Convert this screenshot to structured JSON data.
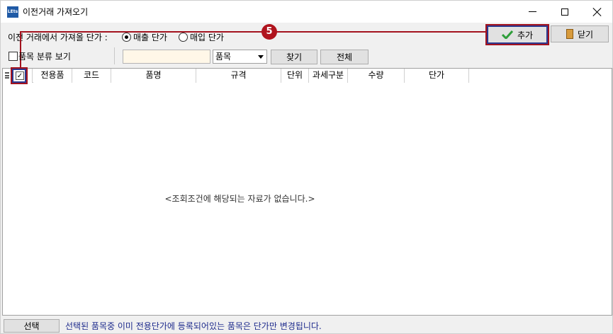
{
  "window": {
    "title": "이전거래 가져오기",
    "icon_label": "LEts"
  },
  "row1": {
    "source_label": "이전 거래에서 가져올 단가 :",
    "radio_sale_label": "매출 단가",
    "radio_buy_label": "매입 단가",
    "radio_selected": "매출 단가",
    "add_button_label": "추가",
    "close_button_label": "닫기"
  },
  "row2": {
    "category_checkbox_label": "품목 분류 보기",
    "search_value": "",
    "search_field_selected": "품목",
    "find_button_label": "찾기",
    "all_button_label": "전체"
  },
  "grid": {
    "columns": [
      "전용품",
      "코드",
      "품명",
      "규격",
      "단위",
      "과세구분",
      "수량",
      "단가"
    ],
    "header_checkbox_checked": true,
    "empty_message": "<조회조건에 해당되는 자료가 없습니다.>"
  },
  "annotation": {
    "step_number": "5"
  },
  "footer": {
    "select_button_label": "선택",
    "message": "선택된 품목중 이미 전용단가에 등록되어있는 품목은 단가만 변경됩니다."
  },
  "colors": {
    "callout": "#a3121e",
    "highlight_border": "#2b3990",
    "footer_text": "#1d2a8c"
  },
  "icons": {
    "add": "checkmark-icon",
    "close": "door-icon",
    "grid_menu": "menu-icon"
  }
}
